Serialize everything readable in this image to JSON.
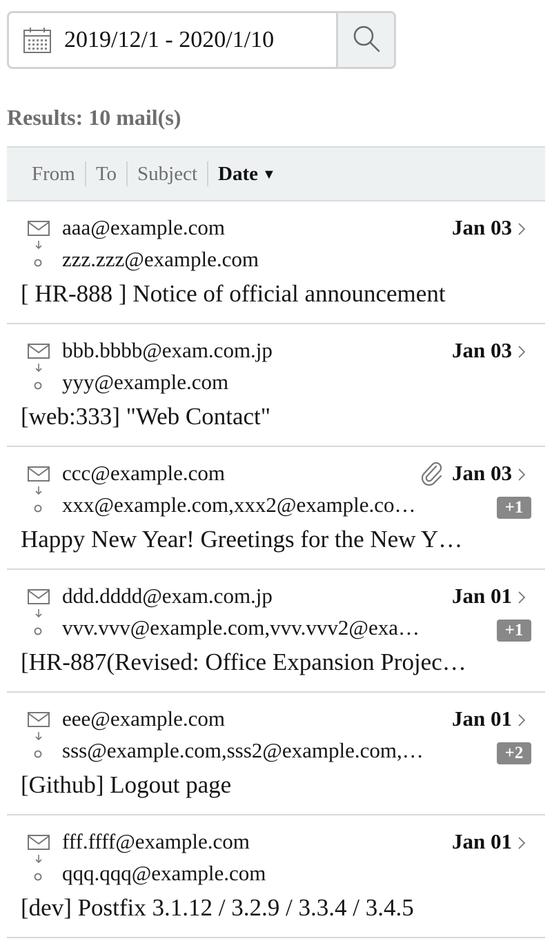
{
  "search": {
    "date_range": "2019/12/1 - 2020/1/10",
    "icon": "search-icon",
    "date_icon": "calendar-icon"
  },
  "results": {
    "label": "Results: 10 mail(s)"
  },
  "sort": {
    "items": [
      {
        "label": "From"
      },
      {
        "label": "To"
      },
      {
        "label": "Subject"
      },
      {
        "label": "Date"
      }
    ],
    "active": "Date",
    "direction_icon": "caret-down-icon"
  },
  "colors": {
    "header_bg": "#eef1f2",
    "badge_bg": "#888888",
    "divider": "#d8d8d8",
    "muted_text": "#6e6e6e"
  },
  "mails": [
    {
      "from": "aaa@example.com",
      "to": "zzz.zzz@example.com",
      "subject": "[ HR-888 ] Notice of official announcement",
      "date": "Jan 03",
      "attachment": false,
      "extra_recipients": ""
    },
    {
      "from": "bbb.bbbb@exam.com.jp",
      "to": "yyy@example.com",
      "subject": "[web:333] \"Web Contact\"",
      "date": "Jan 03",
      "attachment": false,
      "extra_recipients": ""
    },
    {
      "from": "ccc@example.com",
      "to": "xxx@example.com,xxx2@example.co…",
      "subject": "Happy New Year! Greetings for the New Y…",
      "date": "Jan 03",
      "attachment": true,
      "extra_recipients": "+1"
    },
    {
      "from": "ddd.dddd@exam.com.jp",
      "to": "vvv.vvv@example.com,vvv.vvv2@exa…",
      "subject": "[HR-887(Revised: Office Expansion Projec…",
      "date": "Jan 01",
      "attachment": false,
      "extra_recipients": "+1"
    },
    {
      "from": "eee@example.com",
      "to": "sss@example.com,sss2@example.com,…",
      "subject": "[Github] Logout page",
      "date": "Jan 01",
      "attachment": false,
      "extra_recipients": "+2"
    },
    {
      "from": "fff.ffff@example.com",
      "to": "qqq.qqq@example.com",
      "subject": "[dev] Postfix 3.1.12 / 3.2.9 / 3.3.4 / 3.4.5",
      "date": "Jan 01",
      "attachment": false,
      "extra_recipients": ""
    }
  ]
}
